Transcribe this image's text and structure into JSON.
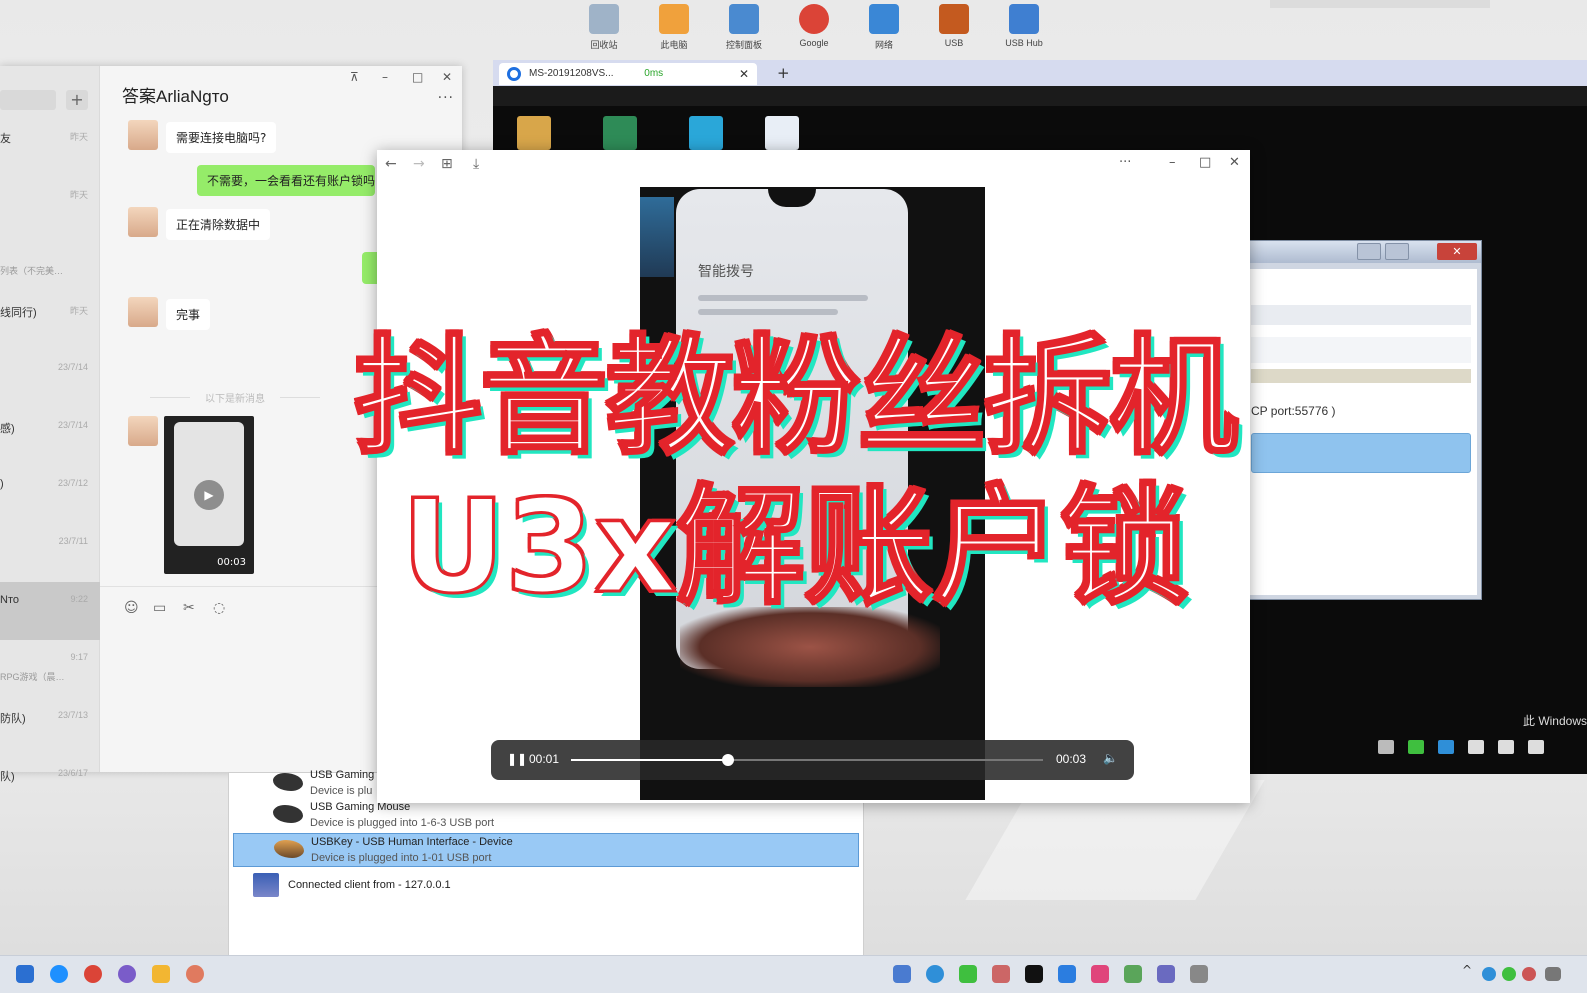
{
  "desktop": {
    "icons": [
      {
        "label": "回收站",
        "icon": "recycle-bin-icon",
        "color": "#9fb3c8"
      },
      {
        "label": "此电脑",
        "icon": "computer-icon",
        "color": "#f0a13c"
      },
      {
        "label": "控制面板",
        "icon": "control-panel-icon",
        "color": "#4a8ad0"
      },
      {
        "label": "Google",
        "icon": "chrome-icon",
        "color": "#db4437"
      },
      {
        "label": "网络",
        "icon": "network-icon",
        "color": "#3a87d6"
      },
      {
        "label": "USB",
        "icon": "usb-tool-icon",
        "color": "#c45a1f"
      },
      {
        "label": "USB Hub",
        "icon": "usb-hub-icon",
        "color": "#3f7fd1"
      }
    ]
  },
  "chat": {
    "title": "答案ArliaNgто",
    "add_button": "+",
    "more": "···",
    "window_controls": {
      "pin": "⊼",
      "minimize": "–",
      "maximize": "□",
      "close": "✕"
    },
    "conversations": [
      {
        "name": "友",
        "sub": "",
        "time": "昨天"
      },
      {
        "name": "",
        "sub": "",
        "time": "昨天"
      },
      {
        "name": "",
        "sub": "列表（不完美…",
        "time": ""
      },
      {
        "name": "线同行)",
        "sub": "",
        "time": "昨天"
      },
      {
        "name": "",
        "sub": "",
        "time": "23/7/14"
      },
      {
        "name": "感)",
        "sub": "",
        "time": "23/7/14"
      },
      {
        "name": ")",
        "sub": "",
        "time": "23/7/12"
      },
      {
        "name": "",
        "sub": "",
        "time": "23/7/11"
      },
      {
        "name": "Nто",
        "sub": "",
        "time": "9:22",
        "active": true
      },
      {
        "name": "",
        "sub": "RPG游戏（晨…",
        "time": "9:17"
      },
      {
        "name": "防队)",
        "sub": "",
        "time": "23/7/13"
      },
      {
        "name": "队)",
        "sub": "",
        "time": "23/6/17"
      }
    ],
    "messages": [
      {
        "side": "left",
        "text": "需要连接电脑吗?"
      },
      {
        "side": "right",
        "text": "不需要，一会看看还有账户锁吗"
      },
      {
        "side": "left",
        "text": "正在清除数据中"
      },
      {
        "side": "left",
        "text": "完事"
      }
    ],
    "divider": "以下是新消息",
    "video_duration": "00:03",
    "toolbar_icons": [
      "emoji-icon",
      "folder-icon",
      "scissors-icon",
      "chat-bubble-icon"
    ]
  },
  "remote": {
    "tab_title": "MS-20191208VS...",
    "ping": "0ms",
    "add_tab": "+",
    "dialog_port_text": "CP port:55776 )",
    "windows_label": "此 Windows"
  },
  "usb_list": {
    "items": [
      {
        "title": "USB Gaming",
        "detail": "Device is plu",
        "selected": false
      },
      {
        "title": "USB Gaming Mouse",
        "detail": "Device is plugged into 1-6-3 USB port",
        "selected": false
      },
      {
        "title": "USBKey - USB Human Interface - Device",
        "detail": "Device is plugged into 1-01 USB port",
        "selected": true
      }
    ],
    "connected": "Connected client from - 127.0.0.1"
  },
  "viewer": {
    "back": "←",
    "forward": "→",
    "grid": "⊞",
    "save": "⤓",
    "more": "···",
    "minimize": "–",
    "maximize": "□",
    "close": "✕",
    "phone_screen_title": "智能拨号",
    "current_time": "00:01",
    "total_time": "00:03",
    "progress_fraction": 0.333,
    "pause_icon": "❚❚",
    "volume_icon": "🔈"
  },
  "overlay": {
    "line1": "抖音教粉丝拆机",
    "line2": "U3x解账户锁",
    "colors": {
      "fill": "#ffffff",
      "stroke": "#e3242b",
      "shadow": "#21e6c1"
    }
  },
  "taskbar": {
    "tray_caret": "^",
    "icons": [
      "start-icon",
      "edge-icon",
      "chrome-icon",
      "app-icon",
      "folder-icon",
      "app-icon",
      "wechat-icon",
      "tiktok-icon",
      "app-icon"
    ]
  }
}
